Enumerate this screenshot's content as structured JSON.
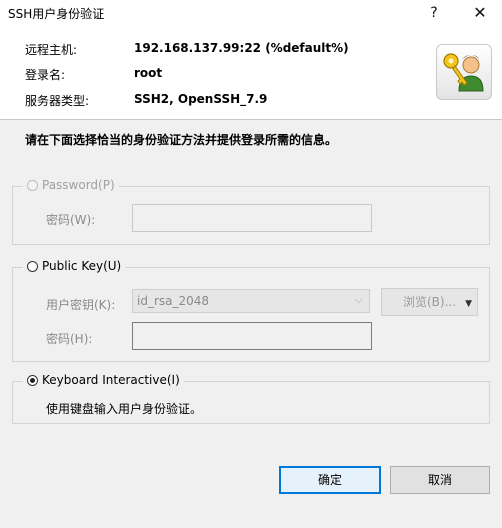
{
  "window": {
    "title": "SSH用户身份验证",
    "help_label": "?",
    "close_label": "✕"
  },
  "info": {
    "host_label": "远程主机:",
    "host_value": "192.168.137.99:22 (%default%)",
    "login_label": "登录名:",
    "login_value": "root",
    "server_type_label": "服务器类型:",
    "server_type_value": "SSH2, OpenSSH_7.9",
    "avatar_icon": "user-key-icon"
  },
  "instruction": "请在下面选择恰当的身份验证方法并提供登录所需的信息。",
  "password_group": {
    "label": "Password(P)",
    "field_label": "密码(W):",
    "selected": false,
    "enabled": false
  },
  "publickey_group": {
    "label": "Public Key(U)",
    "key_label": "用户密钥(K):",
    "key_value": "id_rsa_2048",
    "browse_label": "浏览(B)...",
    "passphrase_label": "密码(H):",
    "selected": false
  },
  "keyboard_group": {
    "label": "Keyboard Interactive(I)",
    "description": "使用键盘输入用户身份验证。",
    "selected": true
  },
  "buttons": {
    "ok": "确定",
    "cancel": "取消"
  },
  "colors": {
    "accent": "#0078d7",
    "background": "#f0f0f0"
  }
}
